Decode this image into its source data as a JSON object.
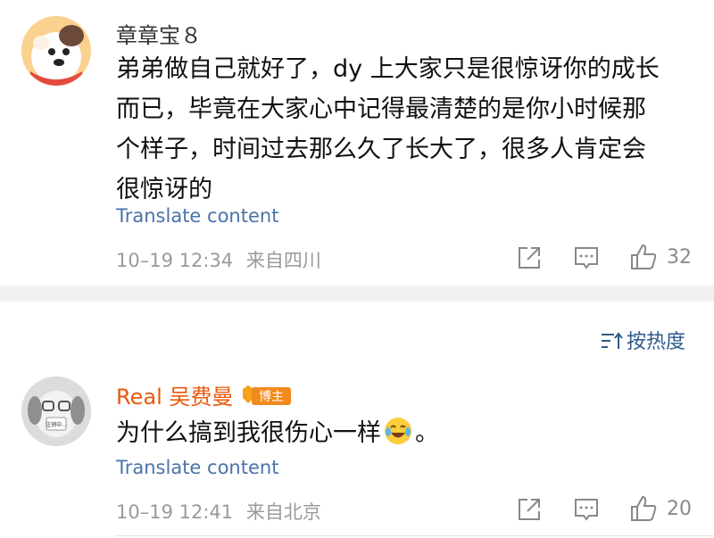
{
  "comment1": {
    "username": "章章宝８",
    "text_lines": [
      "弟弟做自己就好了，dy 上大家只是很惊讶你的成长",
      "而已，毕竟在大家心中记得最清楚的是你小时候那",
      "个样子，时间过去那么久了长大了，很多人肯定会",
      "很惊讶的"
    ],
    "translate_label": "Translate content",
    "timestamp": "10–19 12:34",
    "location": "来自四川",
    "like_count": "32"
  },
  "sort_label": "按热度",
  "comment2": {
    "username": "Real 吴费曼",
    "badge_label": "博主",
    "text": "为什么搞到我很伤心一样",
    "text_suffix": "。",
    "avatar_text": "注销中...",
    "translate_label": "Translate content",
    "timestamp": "10–19 12:41",
    "location": "来自北京",
    "like_count": "20"
  },
  "colors": {
    "username_default": "#333333",
    "username_highlight": "#e8590c",
    "link": "#4a73a8",
    "meta": "#9a9a9a"
  }
}
